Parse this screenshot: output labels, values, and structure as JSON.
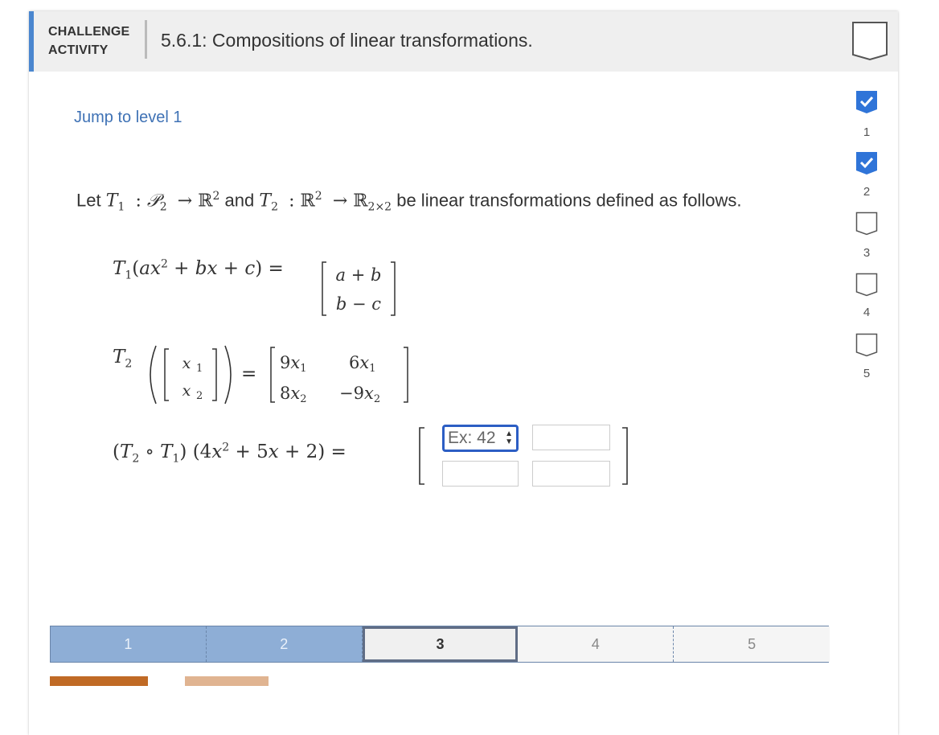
{
  "header": {
    "tag_line1": "CHALLENGE",
    "tag_line2": "ACTIVITY",
    "title": "5.6.1: Compositions of linear transformations."
  },
  "jump_link": "Jump to level 1",
  "prompt": {
    "let": "Let",
    "and": "and",
    "tail": "be linear transformations defined as follows."
  },
  "answer_inputs": {
    "top_left_placeholder": "Ex: 42"
  },
  "levels": [
    {
      "label": "1",
      "state": "done"
    },
    {
      "label": "2",
      "state": "done"
    },
    {
      "label": "3",
      "state": "current"
    },
    {
      "label": "4",
      "state": "todo"
    },
    {
      "label": "5",
      "state": "todo"
    }
  ],
  "side_progress": [
    {
      "label": "1",
      "state": "done"
    },
    {
      "label": "2",
      "state": "done"
    },
    {
      "label": "3",
      "state": "todo"
    },
    {
      "label": "4",
      "state": "todo"
    },
    {
      "label": "5",
      "state": "todo"
    }
  ],
  "colors": {
    "accent_blue": "#4a86cf",
    "done_level": "#8eaed6",
    "focus_border": "#2c5ec4",
    "button_primary": "#c06a25"
  }
}
